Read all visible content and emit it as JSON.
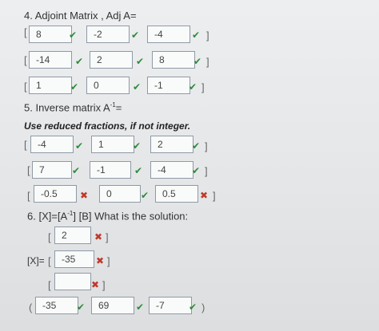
{
  "q4": {
    "heading": "4. Adjoint Matrix , Adj A=",
    "rows": [
      [
        "8",
        "-2",
        "-4"
      ],
      [
        "-14",
        "2",
        "8"
      ],
      [
        "1",
        "0",
        "-1"
      ]
    ]
  },
  "q5": {
    "heading": "5. Inverse matrix A",
    "heading_sup": "-1",
    "heading_suffix": "=",
    "instruction": "Use reduced fractions, if not integer.",
    "rows": [
      [
        "-4",
        "1",
        "2"
      ],
      [
        "7",
        "-1",
        "-4"
      ],
      [
        "-0.5",
        "0",
        "0.5"
      ]
    ]
  },
  "q6": {
    "heading": "6. [X]=[A",
    "heading_sup": "-1",
    "heading_suffix": "] [B]   What is the solution:",
    "x_label": "[X]=",
    "values": [
      "2",
      "-35",
      ""
    ],
    "final": [
      "-35",
      "69",
      "-7"
    ]
  },
  "symbols": {
    "open_bracket": "[",
    "close_bracket": "]",
    "open_paren": "(",
    "close_paren": ")",
    "check": "✔",
    "cross": "✖"
  },
  "colors": {
    "correct": "#2f8a3a",
    "incorrect": "#c0392b",
    "box_border": "#8f9aa6"
  }
}
